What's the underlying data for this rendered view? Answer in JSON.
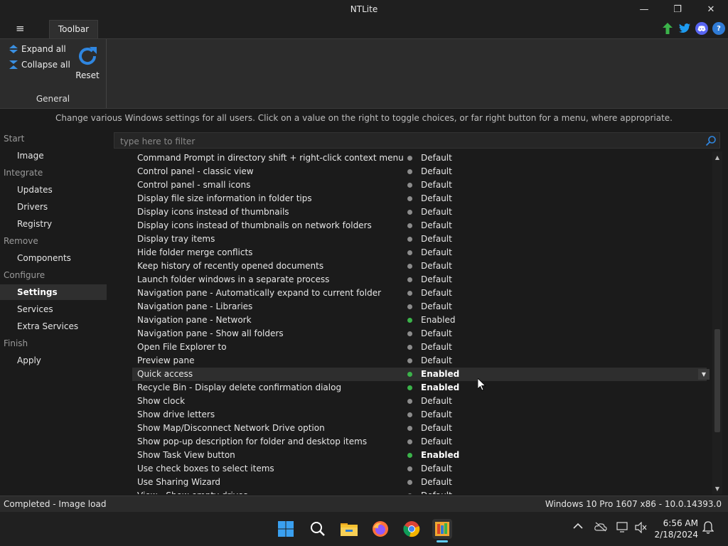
{
  "window": {
    "title": "NTLite",
    "minimize_symbol": "—",
    "restore_symbol": "❐",
    "close_symbol": "✕"
  },
  "ribbon": {
    "menu_symbol": "≡",
    "tab_label": "Toolbar",
    "expand_label": "Expand all",
    "collapse_label": "Collapse all",
    "reset_label": "Reset",
    "group_label": "General",
    "social_icons": [
      "update-arrow-icon",
      "twitter-icon",
      "discord-icon",
      "help-icon"
    ],
    "help_symbol": "?"
  },
  "description": "Change various Windows settings for all users. Click on a value on the right to toggle choices, or far right button for a menu, where appropriate.",
  "sidebar": {
    "items": [
      {
        "label": "Start",
        "type": "head"
      },
      {
        "label": "Image",
        "type": "sub"
      },
      {
        "label": "Integrate",
        "type": "head"
      },
      {
        "label": "Updates",
        "type": "sub"
      },
      {
        "label": "Drivers",
        "type": "sub"
      },
      {
        "label": "Registry",
        "type": "sub"
      },
      {
        "label": "Remove",
        "type": "head"
      },
      {
        "label": "Components",
        "type": "sub"
      },
      {
        "label": "Configure",
        "type": "head"
      },
      {
        "label": "Settings",
        "type": "sub",
        "active": true
      },
      {
        "label": "Services",
        "type": "sub"
      },
      {
        "label": "Extra Services",
        "type": "sub"
      },
      {
        "label": "Finish",
        "type": "head"
      },
      {
        "label": "Apply",
        "type": "sub"
      }
    ]
  },
  "filter": {
    "placeholder": "type here to filter"
  },
  "settings": [
    {
      "name": "Command Prompt in directory shift + right-click context menu",
      "value": "Default"
    },
    {
      "name": "Control panel - classic view",
      "value": "Default"
    },
    {
      "name": "Control panel - small icons",
      "value": "Default"
    },
    {
      "name": "Display file size information in folder tips",
      "value": "Default"
    },
    {
      "name": "Display icons instead of thumbnails",
      "value": "Default"
    },
    {
      "name": "Display icons instead of thumbnails on network folders",
      "value": "Default"
    },
    {
      "name": "Display tray items",
      "value": "Default"
    },
    {
      "name": "Hide folder merge conflicts",
      "value": "Default"
    },
    {
      "name": "Keep history of recently opened documents",
      "value": "Default"
    },
    {
      "name": "Launch folder windows in a separate process",
      "value": "Default"
    },
    {
      "name": "Navigation pane - Automatically expand to current folder",
      "value": "Default"
    },
    {
      "name": "Navigation pane - Libraries",
      "value": "Default"
    },
    {
      "name": "Navigation pane - Network",
      "value": "Enabled",
      "style": "green"
    },
    {
      "name": "Navigation pane - Show all folders",
      "value": "Default"
    },
    {
      "name": "Open File Explorer to",
      "value": "Default"
    },
    {
      "name": "Preview pane",
      "value": "Default"
    },
    {
      "name": "Quick access",
      "value": "Enabled",
      "style": "green-bold",
      "selected": true
    },
    {
      "name": "Recycle Bin - Display delete confirmation dialog",
      "value": "Enabled",
      "style": "green-bold"
    },
    {
      "name": "Show clock",
      "value": "Default"
    },
    {
      "name": "Show drive letters",
      "value": "Default"
    },
    {
      "name": "Show Map/Disconnect Network Drive option",
      "value": "Default"
    },
    {
      "name": "Show pop-up description for folder and desktop items",
      "value": "Default"
    },
    {
      "name": "Show Task View button",
      "value": "Enabled",
      "style": "green-bold"
    },
    {
      "name": "Use check boxes to select items",
      "value": "Default"
    },
    {
      "name": "Use Sharing Wizard",
      "value": "Default"
    },
    {
      "name": "View - Show empty drives",
      "value": "Default"
    }
  ],
  "colors": {
    "enabled_dot": "#3bb34a",
    "default_dot": "#8c8c8c",
    "accent": "#2f7bd6"
  },
  "status": {
    "left": "Completed - Image load",
    "right": "Windows 10 Pro 1607 x86 - 10.0.14393.0"
  },
  "taskbar": {
    "apps": [
      "windows-start-icon",
      "search-icon",
      "file-explorer-icon",
      "firefox-icon",
      "chrome-icon",
      "ntlite-icon"
    ],
    "tray": [
      "chevron-up-icon",
      "onedrive-icon",
      "network-icon",
      "volume-muted-icon"
    ],
    "time": "6:56 AM",
    "date": "2/18/2024"
  }
}
